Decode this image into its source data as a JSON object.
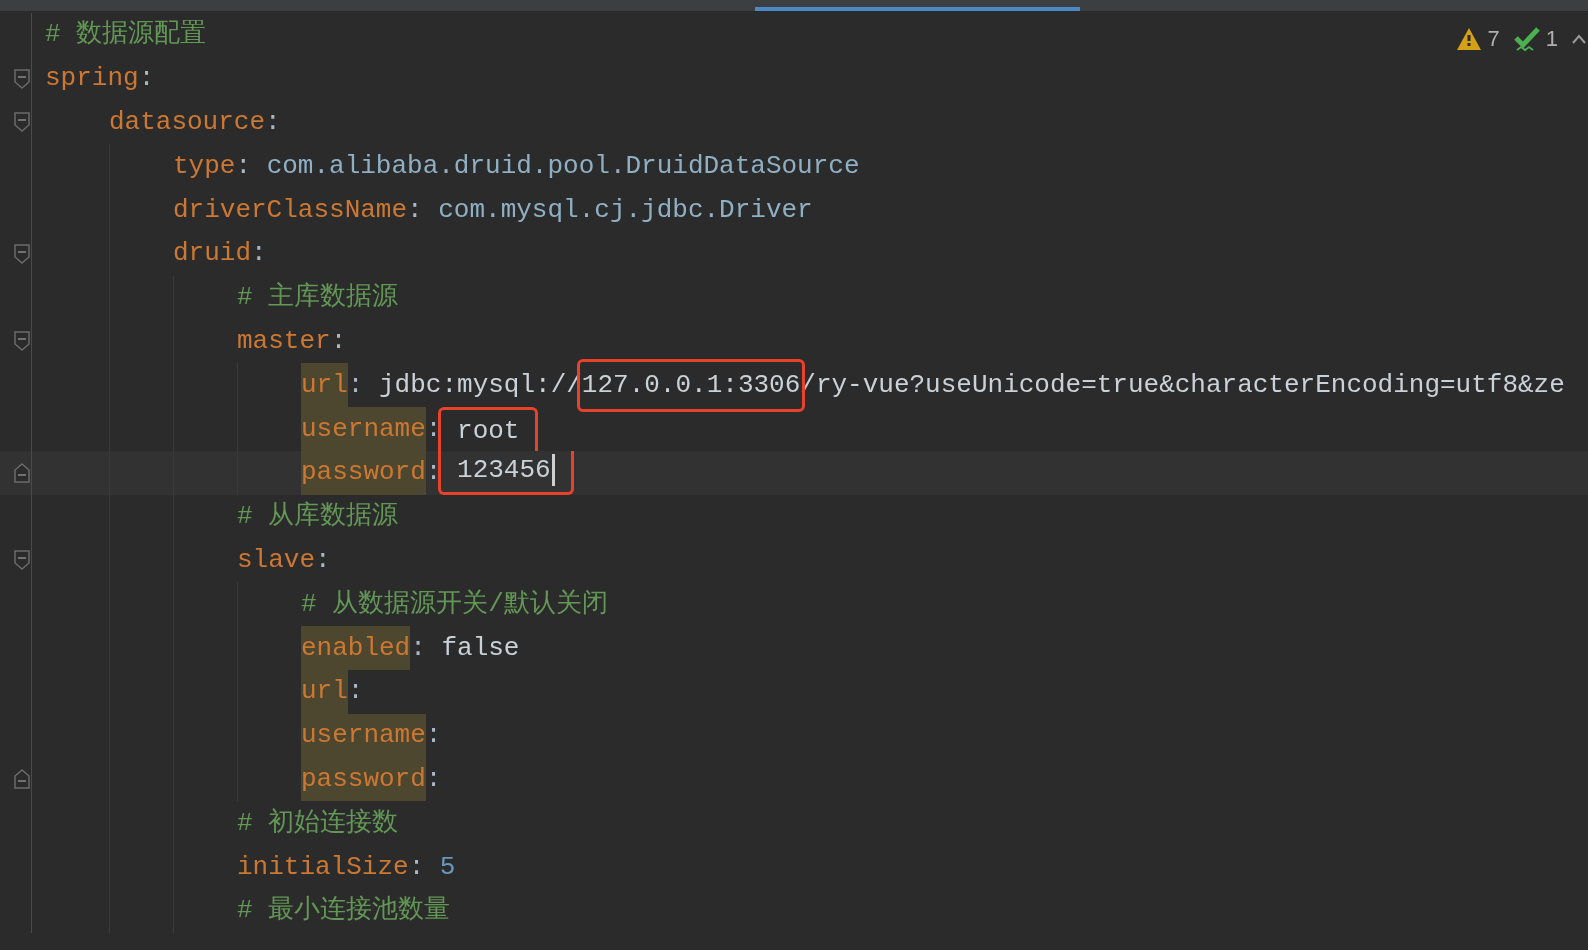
{
  "inspections": {
    "warnings": "7",
    "passed": "1"
  },
  "lines": [
    {
      "kind": "comment",
      "text": "# 数据源配置"
    },
    {
      "kind": "key",
      "key": "spring",
      "sep": ":",
      "children": [
        {
          "kind": "key",
          "key": "datasource",
          "sep": ":",
          "children": [
            {
              "kind": "key",
              "key": "type",
              "sep": ":",
              "value": {
                "kind": "class",
                "text": "com.alibaba.druid.pool.DruidDataSource"
              }
            },
            {
              "kind": "key",
              "key": "driverClassName",
              "sep": ":",
              "value": {
                "kind": "class",
                "text": "com.mysql.cj.jdbc.Driver"
              }
            },
            {
              "kind": "key",
              "key": "druid",
              "sep": ":",
              "children": [
                {
                  "kind": "comment",
                  "text": "# 主库数据源"
                },
                {
                  "kind": "key",
                  "key": "master",
                  "sep": ":",
                  "children": [
                    {
                      "kind": "key",
                      "key": "url",
                      "sep": ":",
                      "highlighted": true,
                      "segments": [
                        {
                          "text": "jdbc:mysql://",
                          "boxed": false
                        },
                        {
                          "text": "127.0.0.1:3306",
                          "boxed": true
                        },
                        {
                          "text": "/ry-vue?useUnicode=true&characterEncoding=utf8&ze",
                          "boxed": false
                        }
                      ]
                    },
                    {
                      "kind": "key",
                      "key": "username",
                      "sep": ":",
                      "highlighted": true,
                      "boxed": true,
                      "value": {
                        "kind": "plain",
                        "text": "root"
                      }
                    },
                    {
                      "kind": "key",
                      "key": "password",
                      "sep": ":",
                      "highlighted": true,
                      "boxed": true,
                      "value": {
                        "kind": "plain",
                        "text": "123456"
                      },
                      "caret": true,
                      "fold_end": true
                    }
                  ]
                },
                {
                  "kind": "comment",
                  "text": "# 从库数据源"
                },
                {
                  "kind": "key",
                  "key": "slave",
                  "sep": ":",
                  "children": [
                    {
                      "kind": "comment",
                      "text": "# 从数据源开关/默认关闭"
                    },
                    {
                      "kind": "key",
                      "key": "enabled",
                      "sep": ":",
                      "highlighted": true,
                      "value": {
                        "kind": "plain",
                        "text": "false"
                      }
                    },
                    {
                      "kind": "key",
                      "key": "url",
                      "sep": ":",
                      "highlighted": true
                    },
                    {
                      "kind": "key",
                      "key": "username",
                      "sep": ":",
                      "highlighted": true
                    },
                    {
                      "kind": "key",
                      "key": "password",
                      "sep": ":",
                      "highlighted": true,
                      "fold_end": true
                    }
                  ]
                },
                {
                  "kind": "comment",
                  "text": "# 初始连接数"
                },
                {
                  "kind": "key",
                  "key": "initialSize",
                  "sep": ":",
                  "value": {
                    "kind": "number",
                    "text": "5"
                  }
                },
                {
                  "kind": "comment",
                  "text": "# 最小连接池数量"
                }
              ]
            }
          ]
        }
      ]
    }
  ]
}
